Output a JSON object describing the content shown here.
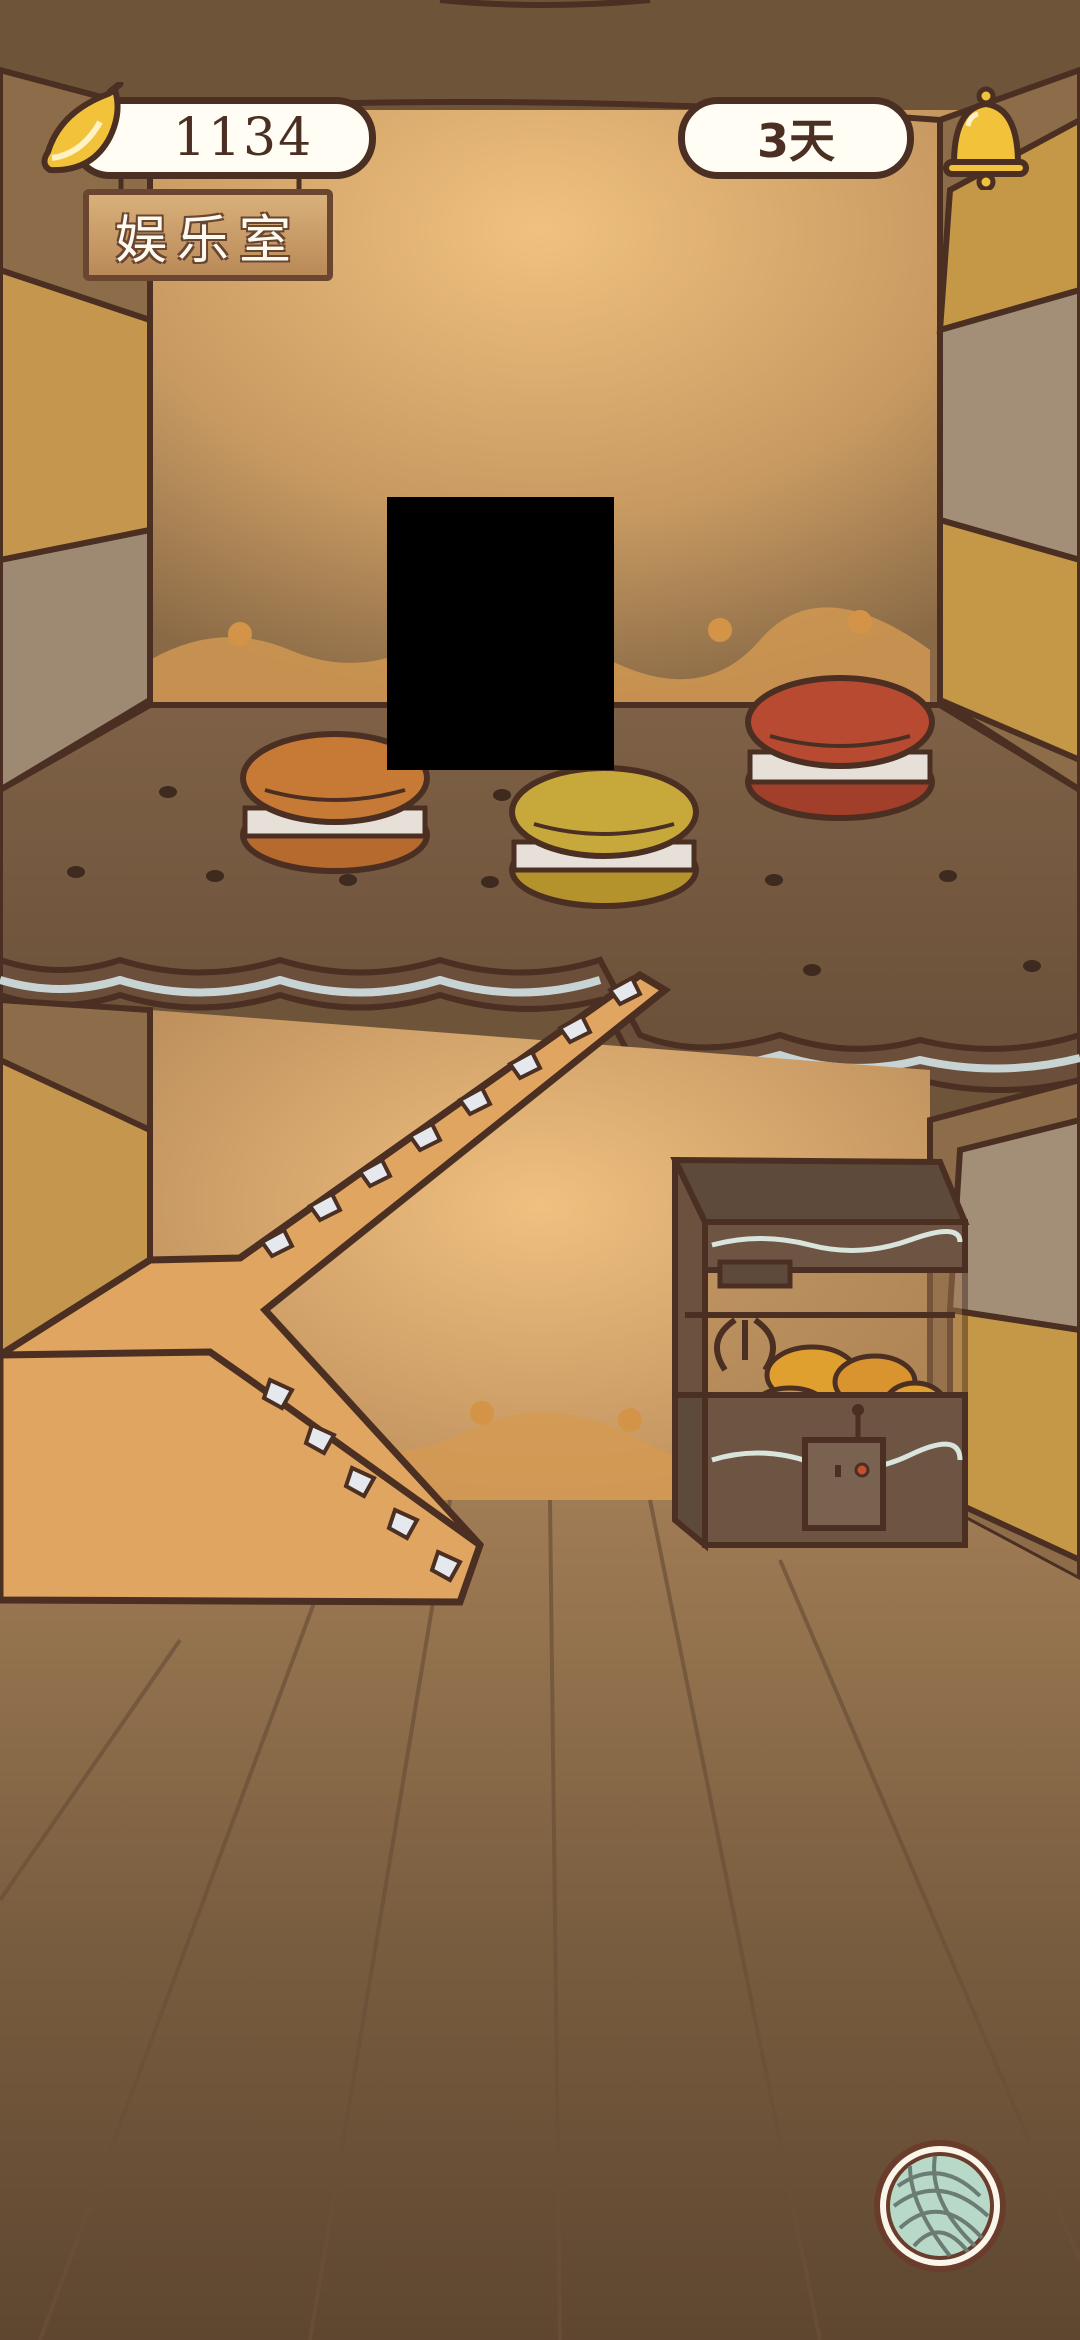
{
  "hud": {
    "banana_count": "1134",
    "days": "3天",
    "room_name": "娱乐室"
  },
  "icons": {
    "currency": "banana-icon",
    "notifications": "bell-icon",
    "yarn": "yarn-ball-icon"
  },
  "scene": {
    "macarons": [
      {
        "name": "orange-macaron",
        "color": "#c77a35"
      },
      {
        "name": "yellow-macaron",
        "color": "#c7a83a"
      },
      {
        "name": "red-macaron",
        "color": "#b84a32"
      }
    ],
    "furniture": [
      "wooden-slide",
      "claw-machine"
    ]
  },
  "colors": {
    "outline": "#4a2f22",
    "wall_light": "#efc07d",
    "floor": "#7d6245",
    "pill_bg": "#fffdf4"
  }
}
